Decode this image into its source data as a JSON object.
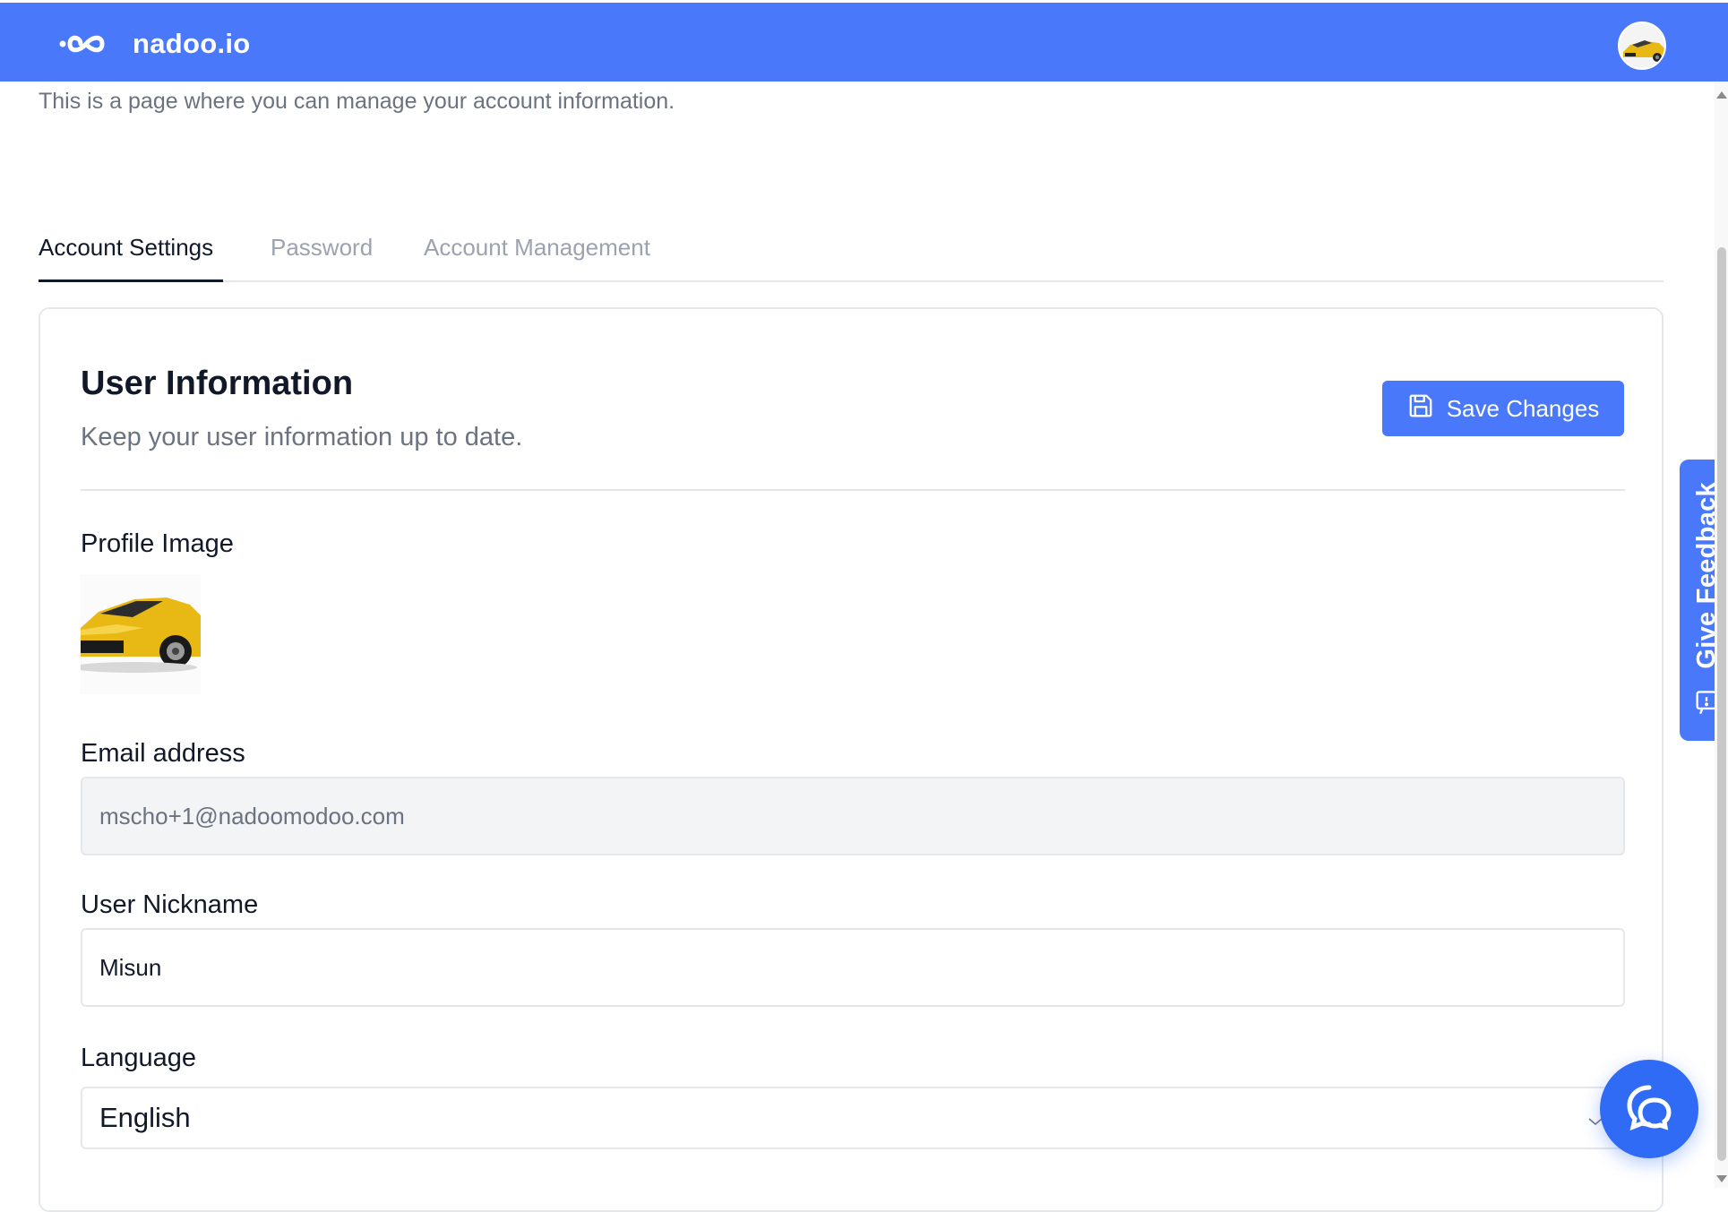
{
  "header": {
    "brand": "nadoo.io",
    "logo_icon": "infinity-logo-icon",
    "avatar_icon": "user-avatar-car"
  },
  "page": {
    "description": "This is a page where you can manage your account information."
  },
  "tabs": [
    {
      "label": "Account Settings",
      "active": true
    },
    {
      "label": "Password",
      "active": false
    },
    {
      "label": "Account Management",
      "active": false
    }
  ],
  "card": {
    "title": "User Information",
    "subtitle": "Keep your user information up to date.",
    "save_label": "Save Changes",
    "save_icon": "floppy-disk-icon"
  },
  "fields": {
    "profile_image_label": "Profile Image",
    "email_label": "Email address",
    "email_value": "mscho+1@nadoomodoo.com",
    "nickname_label": "User Nickname",
    "nickname_value": "Misun",
    "language_label": "Language",
    "language_value": "English"
  },
  "feedback": {
    "label": "Give Feedback",
    "icon": "feedback-icon"
  },
  "chat": {
    "icon": "chat-bubble-icon"
  },
  "colors": {
    "brand": "#4a78fa",
    "chat": "#2f6bf5"
  }
}
